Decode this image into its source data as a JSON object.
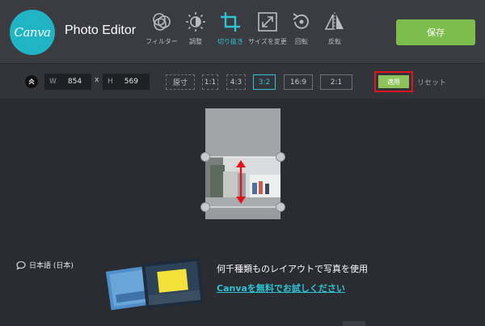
{
  "app": {
    "logo_text": "Canva",
    "title": "Photo Editor"
  },
  "toolbar": {
    "tools": [
      {
        "label": "フィルター",
        "icon": "filter-circles-icon",
        "active": false
      },
      {
        "label": "調整",
        "icon": "brightness-sun-icon",
        "active": false
      },
      {
        "label": "切り抜き",
        "icon": "crop-icon",
        "active": true
      },
      {
        "label": "サイズを変更",
        "icon": "resize-arrows-icon",
        "active": false
      },
      {
        "label": "回転",
        "icon": "rotate-icon",
        "active": false
      },
      {
        "label": "反転",
        "icon": "flip-icon",
        "active": false
      }
    ],
    "save_label": "保存"
  },
  "crop": {
    "width_label": "W",
    "width_value": "854",
    "height_label": "H",
    "height_value": "569",
    "times": "x",
    "ratios": [
      "原寸",
      "1:1",
      "4:3",
      "3:2",
      "16:9",
      "2:1"
    ],
    "active_ratio": "3:2",
    "apply_label": "適用",
    "reset_label": "リセット"
  },
  "footer": {
    "language": "日本語 (日本)",
    "promo_text": "何千種類ものレイアウトで写真を使用",
    "promo_link": "Canvaを無料でお試しください"
  },
  "colors": {
    "accent": "#2fc4d3",
    "save": "#7cbd4b",
    "apply": "#8ec25a",
    "highlight": "#e0141b"
  }
}
